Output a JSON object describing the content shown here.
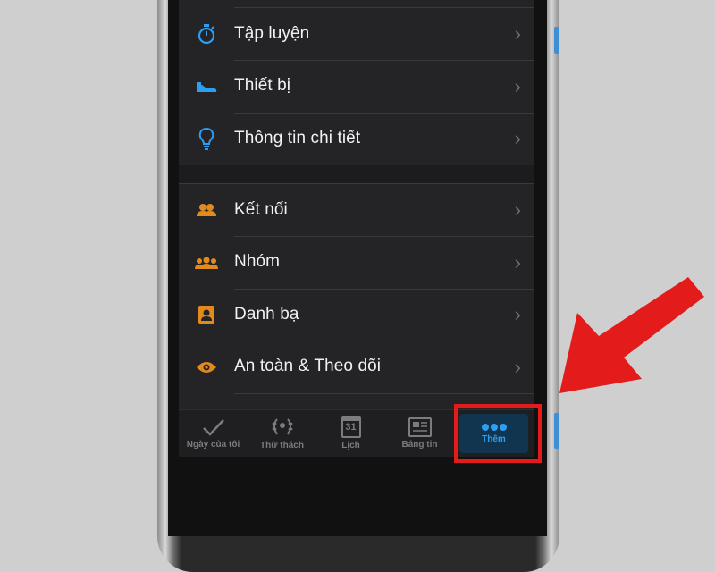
{
  "colors": {
    "accent_blue": "#2e9ef0",
    "accent_orange": "#e38a1f",
    "annotation_red": "#e31b1b",
    "background": "#1c1c1e"
  },
  "menu_sections": [
    {
      "items": [
        {
          "label": "Tập luyện",
          "icon": "stopwatch-icon"
        },
        {
          "label": "Thiết bị",
          "icon": "shoe-icon"
        },
        {
          "label": "Thông tin chi tiết",
          "icon": "lightbulb-icon"
        }
      ]
    },
    {
      "items": [
        {
          "label": "Kết nối",
          "icon": "connections-icon"
        },
        {
          "label": "Nhóm",
          "icon": "groups-icon"
        },
        {
          "label": "Danh bạ",
          "icon": "contacts-icon"
        },
        {
          "label": "An toàn & Theo dõi",
          "icon": "eye-icon"
        }
      ]
    }
  ],
  "tabbar": {
    "tabs": [
      {
        "label": "Ngày của tôi",
        "icon": "check-icon"
      },
      {
        "label": "Thử thách",
        "icon": "laurel-icon"
      },
      {
        "label": "Lịch",
        "icon": "calendar-icon",
        "icon_text": "31"
      },
      {
        "label": "Bảng tin",
        "icon": "newsfeed-icon"
      },
      {
        "label": "Thêm",
        "icon": "more-dots-icon",
        "active": true
      }
    ]
  }
}
